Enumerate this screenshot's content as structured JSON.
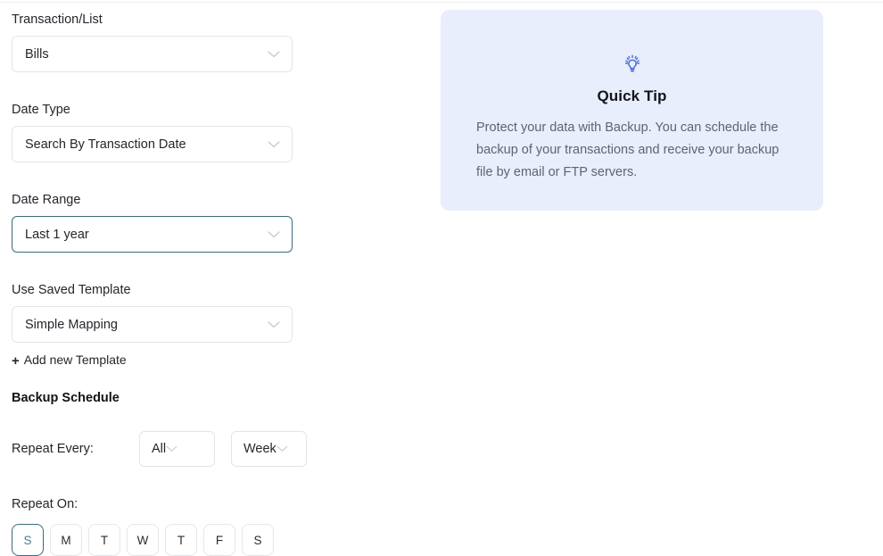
{
  "form": {
    "fields": [
      {
        "label": "Transaction/List",
        "value": "Bills",
        "name": "transaction-list",
        "focused": false
      },
      {
        "label": "Date Type",
        "value": "Search By Transaction Date",
        "name": "date-type",
        "focused": false
      },
      {
        "label": "Date Range",
        "value": "Last 1 year",
        "name": "date-range",
        "focused": true
      },
      {
        "label": "Use Saved Template",
        "value": "Simple Mapping",
        "name": "use-saved-template",
        "focused": false
      }
    ],
    "add_template": {
      "plus": "+",
      "label": "Add new Template"
    },
    "backup_schedule_title": "Backup Schedule",
    "repeat_every": {
      "label": "Repeat Every:",
      "count_value": "All",
      "unit_value": "Week"
    },
    "repeat_on": {
      "label": "Repeat On:",
      "days": [
        {
          "letter": "S",
          "day": "sunday",
          "selected": true
        },
        {
          "letter": "M",
          "day": "monday",
          "selected": false
        },
        {
          "letter": "T",
          "day": "tuesday",
          "selected": false
        },
        {
          "letter": "W",
          "day": "wednesday",
          "selected": false
        },
        {
          "letter": "T",
          "day": "thursday",
          "selected": false
        },
        {
          "letter": "F",
          "day": "friday",
          "selected": false
        },
        {
          "letter": "S",
          "day": "saturday",
          "selected": false
        }
      ]
    }
  },
  "tip_panel": {
    "icon": "lightbulb-icon",
    "title": "Quick Tip",
    "body": "Protect your data with Backup. You can schedule the backup of your transactions and receive your backup file by email or FTP servers."
  },
  "colors": {
    "tip_background": "#e9eefc",
    "tip_icon": "#4d6fd4",
    "focus_border": "#3a6b7d",
    "field_border": "#e2e5e9",
    "text_primary": "#24262c",
    "text_muted": "#5d6473"
  }
}
